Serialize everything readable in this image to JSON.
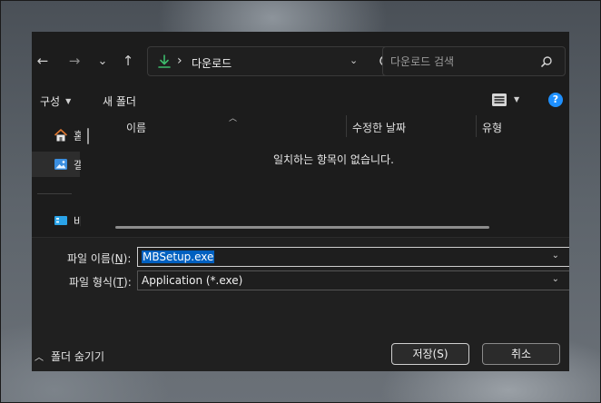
{
  "nav": {
    "back_icon": "←",
    "forward_icon": "→",
    "recent_icon": "⌄",
    "up_icon": "↑"
  },
  "address": {
    "separator": "›",
    "folder": "다운로드"
  },
  "search": {
    "placeholder": "다운로드 검색"
  },
  "toolbar": {
    "organize_label": "구성",
    "new_folder_label": "새 폴더",
    "help_glyph": "?"
  },
  "sidebar": {
    "items": [
      {
        "label": "홈",
        "icon": "home-icon"
      },
      {
        "label": "갤러리",
        "icon": "gallery-icon"
      },
      {
        "label": "바탕 화면",
        "icon": "desktop-icon"
      }
    ]
  },
  "file_list": {
    "columns": [
      "이름",
      "수정한 날짜",
      "유형"
    ],
    "empty_message": "일치하는 항목이 없습니다."
  },
  "form": {
    "filename_label": "파일 이름(",
    "filename_key": "N",
    "filename_label_end": "):",
    "filename_value": "MBSetup.exe",
    "filetype_label": "파일 형식(",
    "filetype_key": "T",
    "filetype_label_end": "):",
    "filetype_value": "Application (*.exe)"
  },
  "footer": {
    "hide_folders_label": "폴더 숨기기",
    "save_label": "저장(S)",
    "cancel_label": "취소"
  },
  "colors": {
    "dialog_bg": "#1c1c1c",
    "accent": "#1e90ff",
    "download_green": "#3dbb6c",
    "selection": "#0060c0"
  }
}
